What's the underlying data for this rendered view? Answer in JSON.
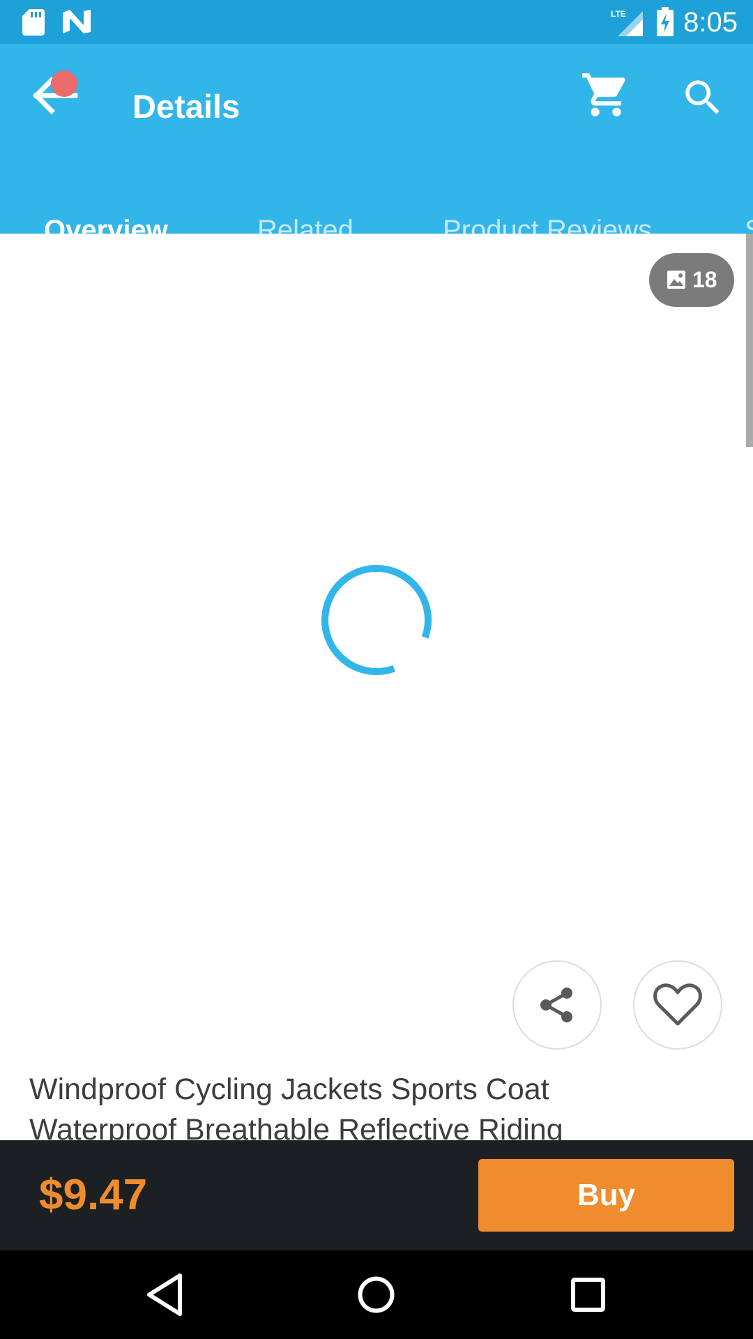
{
  "status_bar": {
    "time": "8:05",
    "icons": [
      "sd-card-icon",
      "n-logo-icon",
      "lte-signal-icon",
      "battery-charging-icon"
    ]
  },
  "app_bar": {
    "title": "Details",
    "icons": [
      "back-arrow-icon",
      "cart-icon",
      "search-icon"
    ],
    "tabs": [
      {
        "label": "Overview",
        "active": true
      },
      {
        "label": "Related",
        "active": false
      },
      {
        "label": "Product Reviews",
        "active": false
      },
      {
        "label": "S",
        "active": false
      }
    ]
  },
  "content": {
    "image_count": "18",
    "product_title": "Windproof Cycling Jackets Sports Coat Waterproof Breathable Reflective Riding"
  },
  "buy_bar": {
    "price": "$9.47",
    "buy_label": "Buy"
  },
  "colors": {
    "app_bar": "#32b5e9",
    "status_bar": "#1da1d8",
    "accent_orange": "#ef8c2e",
    "buy_bar_bg": "#1d2022",
    "notification_dot": "#eb6a6a"
  }
}
